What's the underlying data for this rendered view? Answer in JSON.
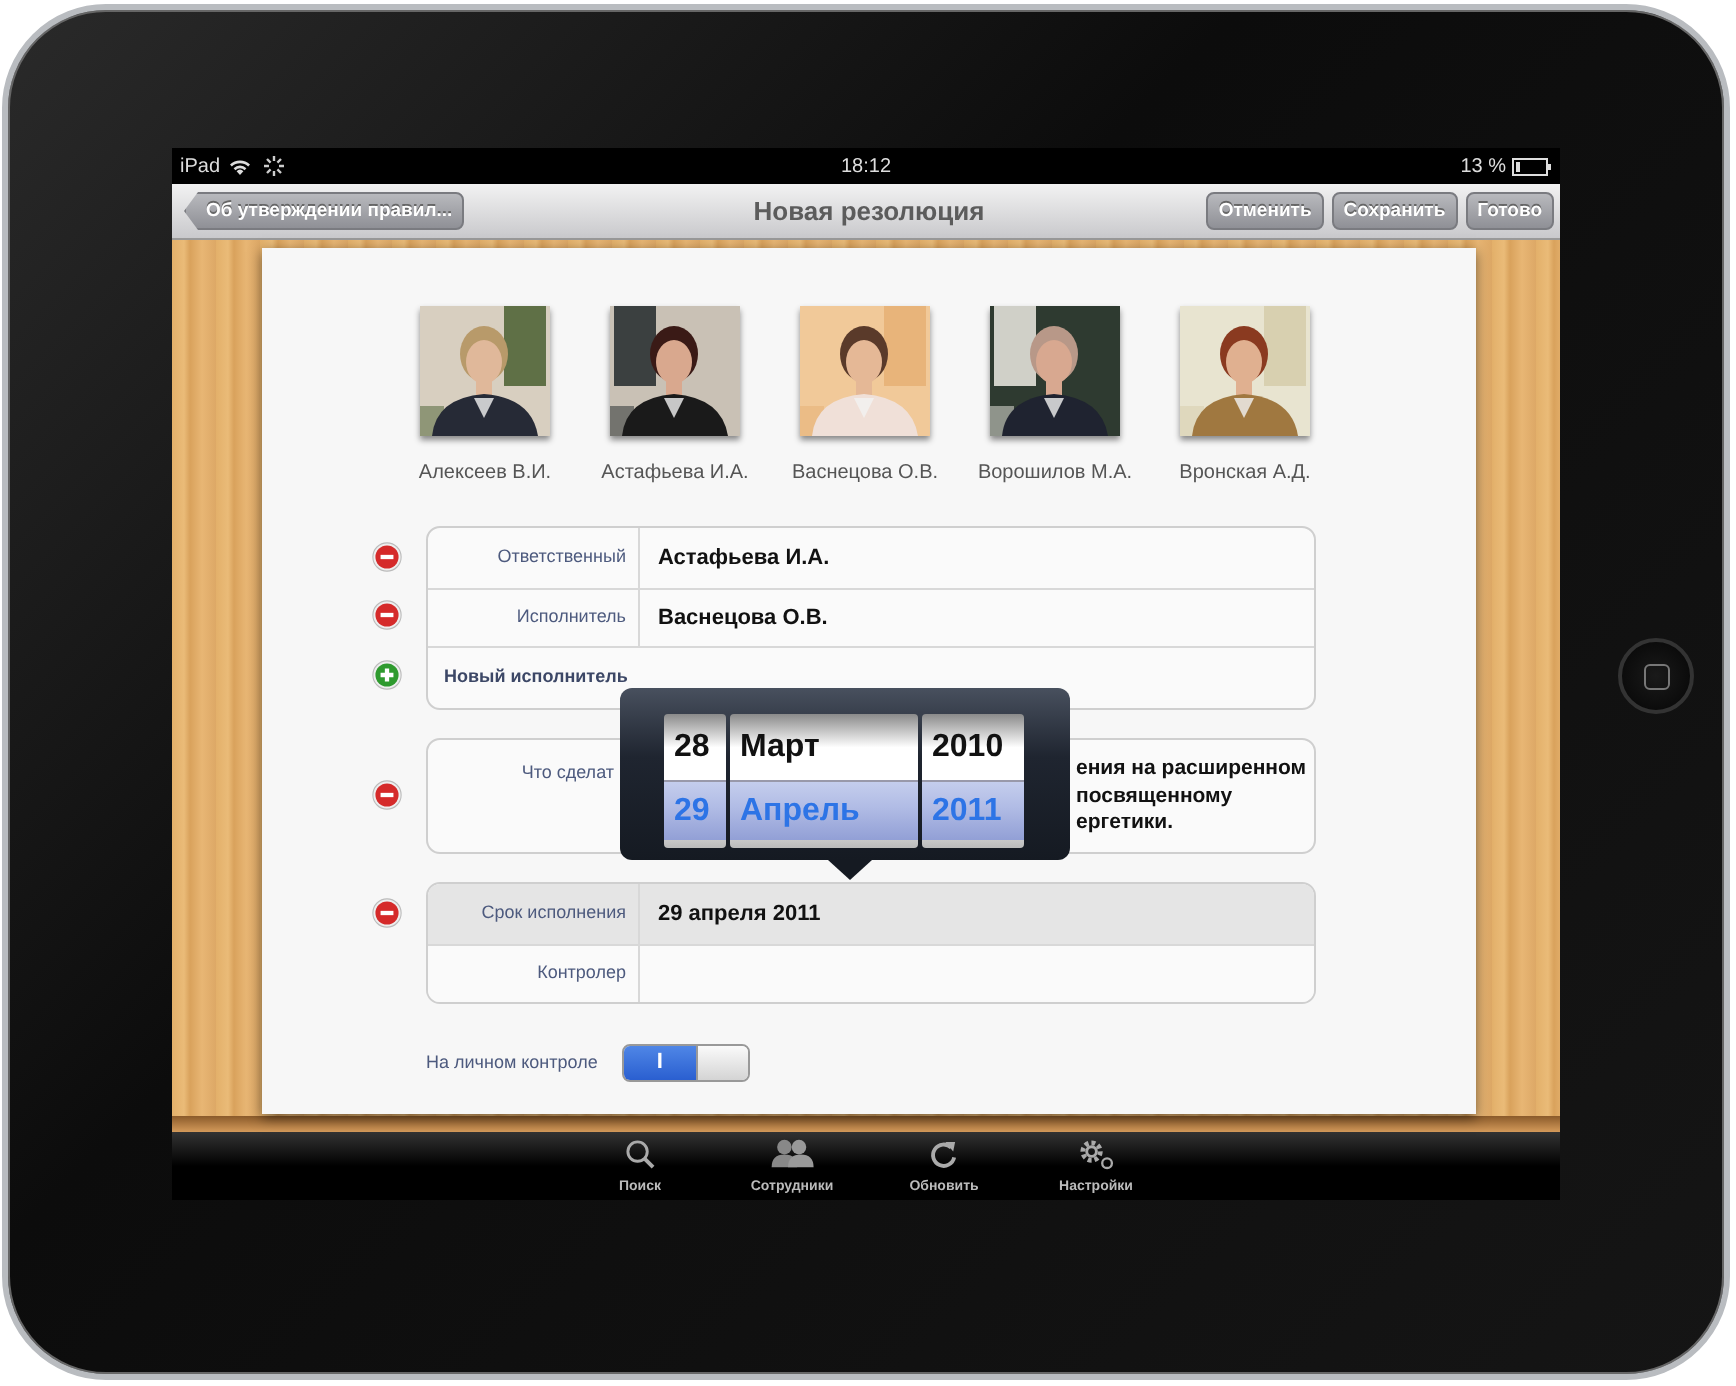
{
  "status_bar": {
    "device": "iPad",
    "time": "18:12",
    "battery": "13 %"
  },
  "nav_bar": {
    "back": "Об утверждении правил...",
    "title": "Новая резолюция",
    "buttons": [
      "Отменить",
      "Сохранить",
      "Готово"
    ]
  },
  "people": [
    {
      "name": "Алексеев В.И.",
      "kind": "picture"
    },
    {
      "name": "Астафьева И.А.",
      "kind": "picture"
    },
    {
      "name": "Васнецова О.В.",
      "kind": "picture"
    },
    {
      "name": "Ворошилов М.А.",
      "kind": "picture"
    },
    {
      "name": "Вронская А.Д.",
      "kind": "picture"
    }
  ],
  "assignment_rows": [
    {
      "kind": "remove",
      "label": "Ответственный",
      "value": "Астафьева И.А."
    },
    {
      "kind": "remove",
      "label": "Исполнитель",
      "value": "Васнецова О.В."
    },
    {
      "kind": "add",
      "label": "Новый исполнитель"
    }
  ],
  "task": {
    "kind": "remove",
    "label": "Что сделат",
    "value_lines": [
      "ения на расширенном",
      "посвященному",
      "ергетики."
    ]
  },
  "deadline_rows": [
    {
      "kind": "remove",
      "label": "Срок исполнения",
      "value": "29 апреля 2011",
      "selected": true
    },
    {
      "kind": "plain",
      "label": "Контролер",
      "selected": false
    }
  ],
  "personal_control": {
    "label": "На личном контроле",
    "switch_text": "I",
    "on": true
  },
  "date_picker": {
    "columns": [
      {
        "above": "28",
        "selected": "29"
      },
      {
        "above": "Март",
        "selected": "Апрель"
      },
      {
        "above": "2010",
        "selected": "2011"
      }
    ]
  },
  "tab_bar": [
    {
      "label": "Поиск",
      "kind": "search"
    },
    {
      "label": "Сотрудники",
      "kind": "people"
    },
    {
      "label": "Обновить",
      "kind": "refresh"
    },
    {
      "label": "Настройки",
      "kind": "settings"
    }
  ]
}
